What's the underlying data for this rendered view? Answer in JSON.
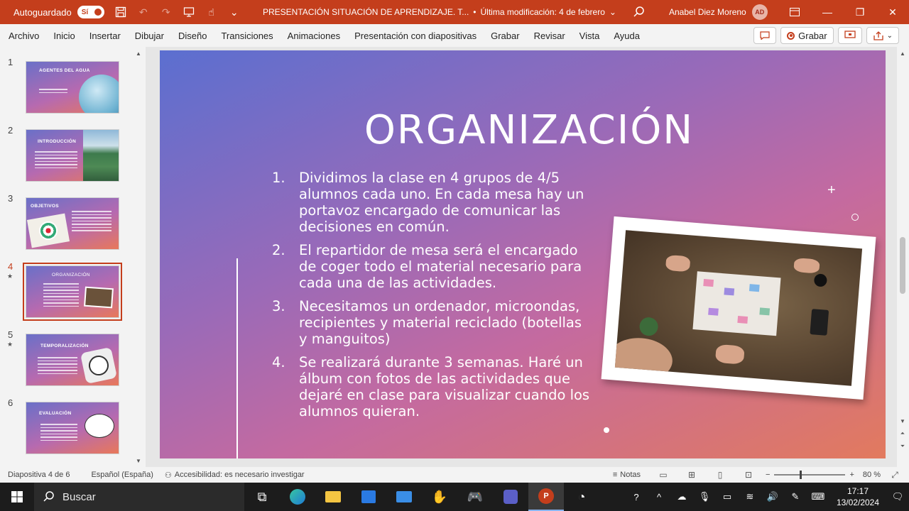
{
  "titlebar": {
    "autosave_label": "Autoguardado",
    "autosave_state": "Sí",
    "document_title": "PRESENTACIÓN SITUACIÓN DE APRENDIZAJE. T...",
    "separator": "•",
    "last_modified": "Última modificación: 4 de febrero",
    "user_name": "Anabel Diez Moreno",
    "user_initials": "AD"
  },
  "ribbon": {
    "tabs": [
      "Archivo",
      "Inicio",
      "Insertar",
      "Dibujar",
      "Diseño",
      "Transiciones",
      "Animaciones",
      "Presentación con diapositivas",
      "Grabar",
      "Revisar",
      "Vista",
      "Ayuda"
    ],
    "record_label": "Grabar"
  },
  "thumbnails": [
    {
      "number": "1",
      "title": "AGENTES DEL AGUA"
    },
    {
      "number": "2",
      "title": "INTRODUCCIÓN"
    },
    {
      "number": "3",
      "title": "OBJETIVOS"
    },
    {
      "number": "4",
      "title": "ORGANIZACIÓN"
    },
    {
      "number": "5",
      "title": "TEMPORALIZACIÓN"
    },
    {
      "number": "6",
      "title": "EVALUACIÓN"
    }
  ],
  "slide": {
    "title": "ORGANIZACIÓN",
    "items": [
      {
        "num": "1.",
        "text": "Dividimos la clase en 4 grupos de 4/5 alumnos cada uno. En cada mesa hay un portavoz encargado de comunicar las decisiones en común."
      },
      {
        "num": "2.",
        "text": "El repartidor de mesa será el encargado de coger todo el material necesario para cada una de las actividades."
      },
      {
        "num": "3.",
        "text": "Necesitamos un ordenador, microondas, recipientes y material reciclado (botellas y manguitos)"
      },
      {
        "num": "4.",
        "text": "Se realizará durante 3 semanas. Haré un álbum con fotos de las actividades que dejaré en clase para visualizar cuando los alumnos quieran."
      }
    ]
  },
  "statusbar": {
    "slide_info": "Diapositiva 4 de 6",
    "language": "Español (España)",
    "accessibility": "Accesibilidad: es necesario investigar",
    "notes_label": "Notas",
    "zoom": "80 %"
  },
  "taskbar": {
    "search_placeholder": "Buscar",
    "time": "17:17",
    "date": "13/02/2024"
  }
}
